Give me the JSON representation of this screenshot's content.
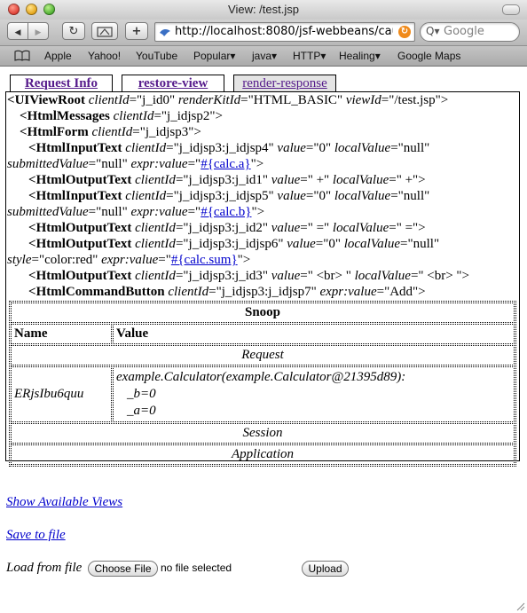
{
  "window": {
    "title": "View: /test.jsp"
  },
  "toolbar": {
    "back_glyph": "◀",
    "forward_glyph": "▶",
    "reload_glyph": "↻",
    "add_glyph": "+",
    "url": "http://localhost:8080/jsf-webbeans/cauc",
    "search_placeholder": "Google",
    "search_glyph": "Q▾"
  },
  "bookmarks": [
    "Apple",
    "Yahoo!",
    "YouTube",
    "Popular▾",
    "java▾",
    "HTTP▾",
    "Healing▾",
    "Google Maps"
  ],
  "tabs": [
    {
      "label": "Request Info"
    },
    {
      "label": "restore-view"
    },
    {
      "label": "render-response"
    }
  ],
  "tree": {
    "root_tag": "UIViewRoot",
    "root_attrs": [
      {
        "name": "clientId",
        "value": "\"j_id0\""
      },
      {
        "name": "renderKitId",
        "value": "\"HTML_BASIC\""
      },
      {
        "name": "viewId",
        "value": "\"/test.jsp\">"
      }
    ],
    "messages_tag": "HtmlMessages",
    "messages_attr": "clientId",
    "messages_value": "\"j_idjsp2\">",
    "form_tag": "HtmlForm",
    "form_attr": "clientId",
    "form_value": "\"j_idjsp3\">",
    "input_a": {
      "tag": "HtmlInputText",
      "l1": "=\"j_idjsp3:j_idjsp4\"",
      "value": "=\"0\"",
      "local": "=\"null\"",
      "submitted": "=\"null\"",
      "expr": "#{calc.a}"
    },
    "out1": {
      "tag": "HtmlOutputText",
      "cid": "=\"j_idjsp3:j_id1\"",
      "value": "=\" +\"",
      "local": "=\" +\">"
    },
    "input_b": {
      "tag": "HtmlInputText",
      "l1": "=\"j_idjsp3:j_idjsp5\"",
      "value": "=\"0\"",
      "local": "=\"null\"",
      "submitted": "=\"null\"",
      "expr": "#{calc.b}"
    },
    "out2": {
      "tag": "HtmlOutputText",
      "cid": "=\"j_idjsp3:j_id2\"",
      "value": "=\" =\"",
      "local": "=\" =\">"
    },
    "out_sum": {
      "tag": "HtmlOutputText",
      "cid": "=\"j_idjsp3:j_idjsp6\"",
      "value": "=\"0\"",
      "local": "=\"null\"",
      "style": "=\"color:red\"",
      "expr": "#{calc.sum}"
    },
    "out3": {
      "tag": "HtmlOutputText",
      "cid": "=\"j_idjsp3:j_id3\"",
      "value": "=\" <br> \"",
      "local": "=\" <br> \">"
    },
    "button": {
      "tag": "HtmlCommandButton",
      "cid": "=\"j_idjsp3:j_idjsp7\"",
      "expr": "=\"Add\">"
    },
    "attr_names": {
      "clientId": "clientId",
      "value": "value",
      "localValue": "localValue",
      "submittedValue": "submittedValue",
      "expr": "expr:value",
      "style": "style"
    }
  },
  "snoop": {
    "title": "Snoop",
    "col_name": "Name",
    "col_value": "Value",
    "request_caption": "Request",
    "row_name": "ERjsIbu6quu",
    "row_value_line1": "example.Calculator(example.Calculator@21395d89):",
    "row_value_line2": "_b=0",
    "row_value_line3": "_a=0",
    "session_caption": "Session",
    "application_caption": "Application"
  },
  "footer": {
    "show_views": "Show Available Views",
    "save_to_file": "Save to file",
    "load_label": "Load from file",
    "choose_file": "Choose File",
    "no_file": "no file selected",
    "upload": "Upload"
  }
}
